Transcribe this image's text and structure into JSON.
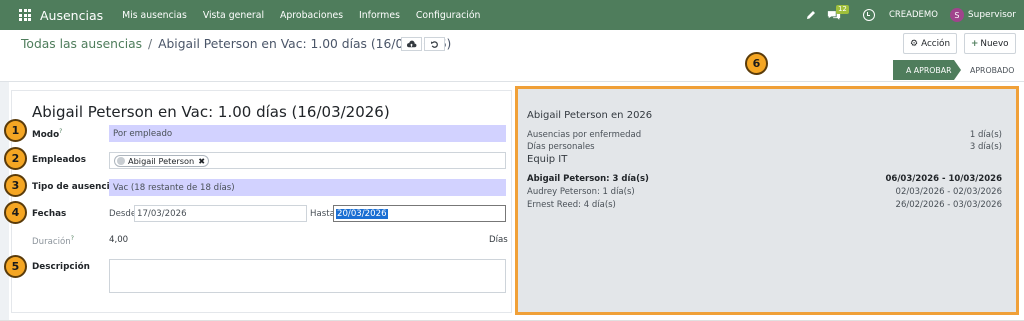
{
  "navbar": {
    "app_name": "Ausencias",
    "menu": [
      "Mis ausencias",
      "Vista general",
      "Aprobaciones",
      "Informes",
      "Configuración"
    ],
    "chat_count": "12",
    "database": "CREADEMO",
    "user_initial": "S",
    "user_name": "Supervisor",
    "color": "#4f7d5c"
  },
  "breadcrumb": {
    "parent": "Todas las ausencias",
    "separator": "/",
    "current": "Abigail Peterson en Vac: 1.00 días (16/03/2026)"
  },
  "actions": {
    "action_label": "Acción",
    "new_label": "Nuevo"
  },
  "statusbar": {
    "stages": [
      "A APROBAR",
      "APROBADO"
    ],
    "active_stage": "A APROBAR"
  },
  "form": {
    "title": "Abigail Peterson en Vac: 1.00 días (16/03/2026)",
    "mode": {
      "label": "Modo",
      "help": "?",
      "value": "Por empleado"
    },
    "employees": {
      "label": "Empleados",
      "tags": [
        "Abigail Peterson"
      ]
    },
    "leave_type": {
      "label": "Tipo de ausencia",
      "value": "Vac (18 restante de 18 días)"
    },
    "dates": {
      "label": "Fechas",
      "from_label": "Desde",
      "from": "17/03/2026",
      "to_label": "Hasta",
      "to": "20/03/2026"
    },
    "duration": {
      "label": "Duración",
      "help": "?",
      "value": "4,00",
      "unit": "Días"
    },
    "description": {
      "label": "Descripción",
      "value": ""
    }
  },
  "side_panel": {
    "title": "Abigail Peterson en 2026",
    "summary": [
      {
        "label": "Ausencias por enfermedad",
        "value": "1 día(s)"
      },
      {
        "label": "Días personales",
        "value": "3 día(s)"
      }
    ],
    "team_heading": "Equip IT",
    "team": [
      {
        "label": "Abigail Peterson: 3 día(s)",
        "range": "06/03/2026 - 10/03/2026",
        "highlight": true
      },
      {
        "label": "Audrey Peterson: 1 día(s)",
        "range": "02/03/2026 - 02/03/2026",
        "highlight": false
      },
      {
        "label": "Ernest Reed: 4 día(s)",
        "range": "26/02/2026 - 03/03/2026",
        "highlight": false
      }
    ]
  },
  "annotations": [
    "1",
    "2",
    "3",
    "4",
    "5",
    "6"
  ],
  "icons": [
    "apps-grid-icon",
    "pencil-icon",
    "chat-icon",
    "clock-icon",
    "cloud-upload-icon",
    "undo-icon",
    "gear-icon",
    "plus-icon"
  ],
  "colors": {
    "brand": "#4f7d5c",
    "required_field": "#d2d2ff",
    "highlight_border": "#f0a038",
    "badge": "#f5a623"
  }
}
